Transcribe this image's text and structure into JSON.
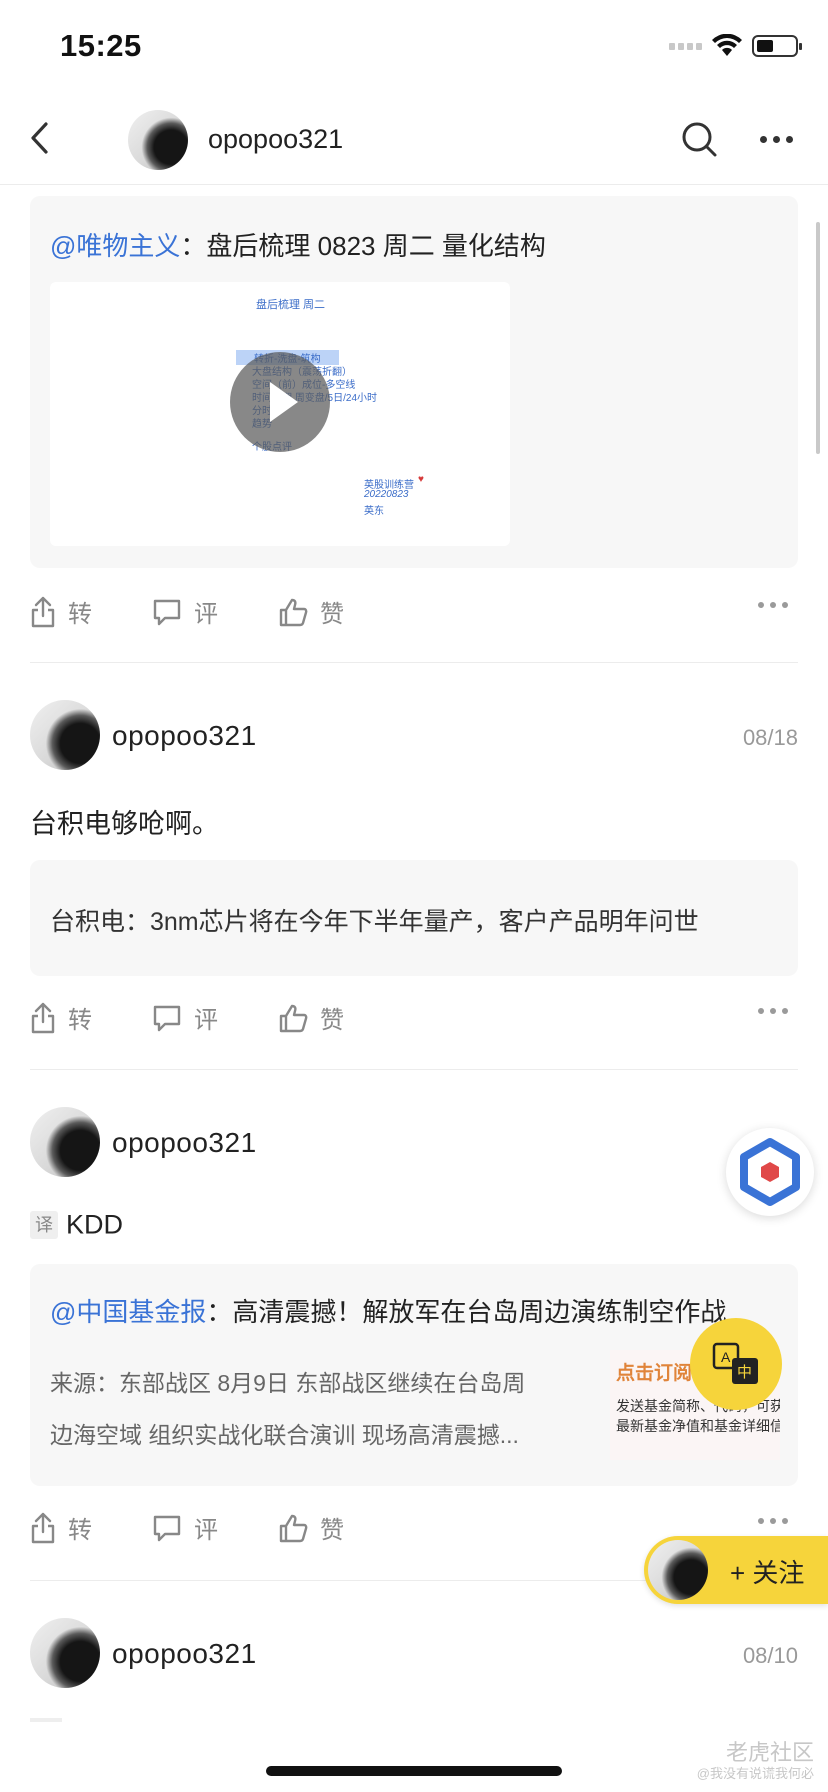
{
  "status_bar": {
    "time": "15:25",
    "battery_level": 0.45
  },
  "header": {
    "username": "opopoo321"
  },
  "posts": [
    {
      "card": {
        "mention": "@唯物主义",
        "separator": "：",
        "title": "盘后梳理 0823 周二 量化结构",
        "video_slide": {
          "title": "盘后梳理 周二",
          "items": [
            "转折-洗盘-筑构",
            "大盘结构（震荡折翻）",
            "空间（前）成位-多空线",
            "时间周期 周变盘/5日/24小时",
            "分时",
            "趋势"
          ],
          "footer": "个股点评",
          "sign_1": "英股训练营",
          "sign_2": "20220823",
          "sign_3": "英东"
        }
      },
      "actions": {
        "share": "转",
        "comment": "评",
        "like": "赞"
      }
    },
    {
      "author": "opopoo321",
      "date": "08/18",
      "text": "台积电够呛啊。",
      "card": {
        "text": "台积电：3nm芯片将在今年下半年量产，客户产品明年问世"
      },
      "actions": {
        "share": "转",
        "comment": "评",
        "like": "赞"
      }
    },
    {
      "author": "opopoo321",
      "translate_tag": "译",
      "text": "KDD",
      "card": {
        "mention": "@中国基金报",
        "separator": "：",
        "title": "高清震撼！解放军在台岛周边演练制空作战",
        "body_line1": "来源：东部战区 8月9日 东部战区继续在台岛周",
        "body_line2": "边海空域 组织实战化联合演训 现场高清震撼...",
        "ad_title": "点击订阅",
        "ad_line1": "发送基金简称、代码，可获",
        "ad_line2": "最新基金净值和基金详细信"
      },
      "actions": {
        "share": "转",
        "comment": "评",
        "like": "赞"
      }
    },
    {
      "author": "opopoo321",
      "date": "08/10"
    }
  ],
  "follow_button": {
    "label": "+ 关注"
  },
  "watermark": {
    "brand": "老虎社区",
    "handle": "@我没有说谎我何必"
  }
}
